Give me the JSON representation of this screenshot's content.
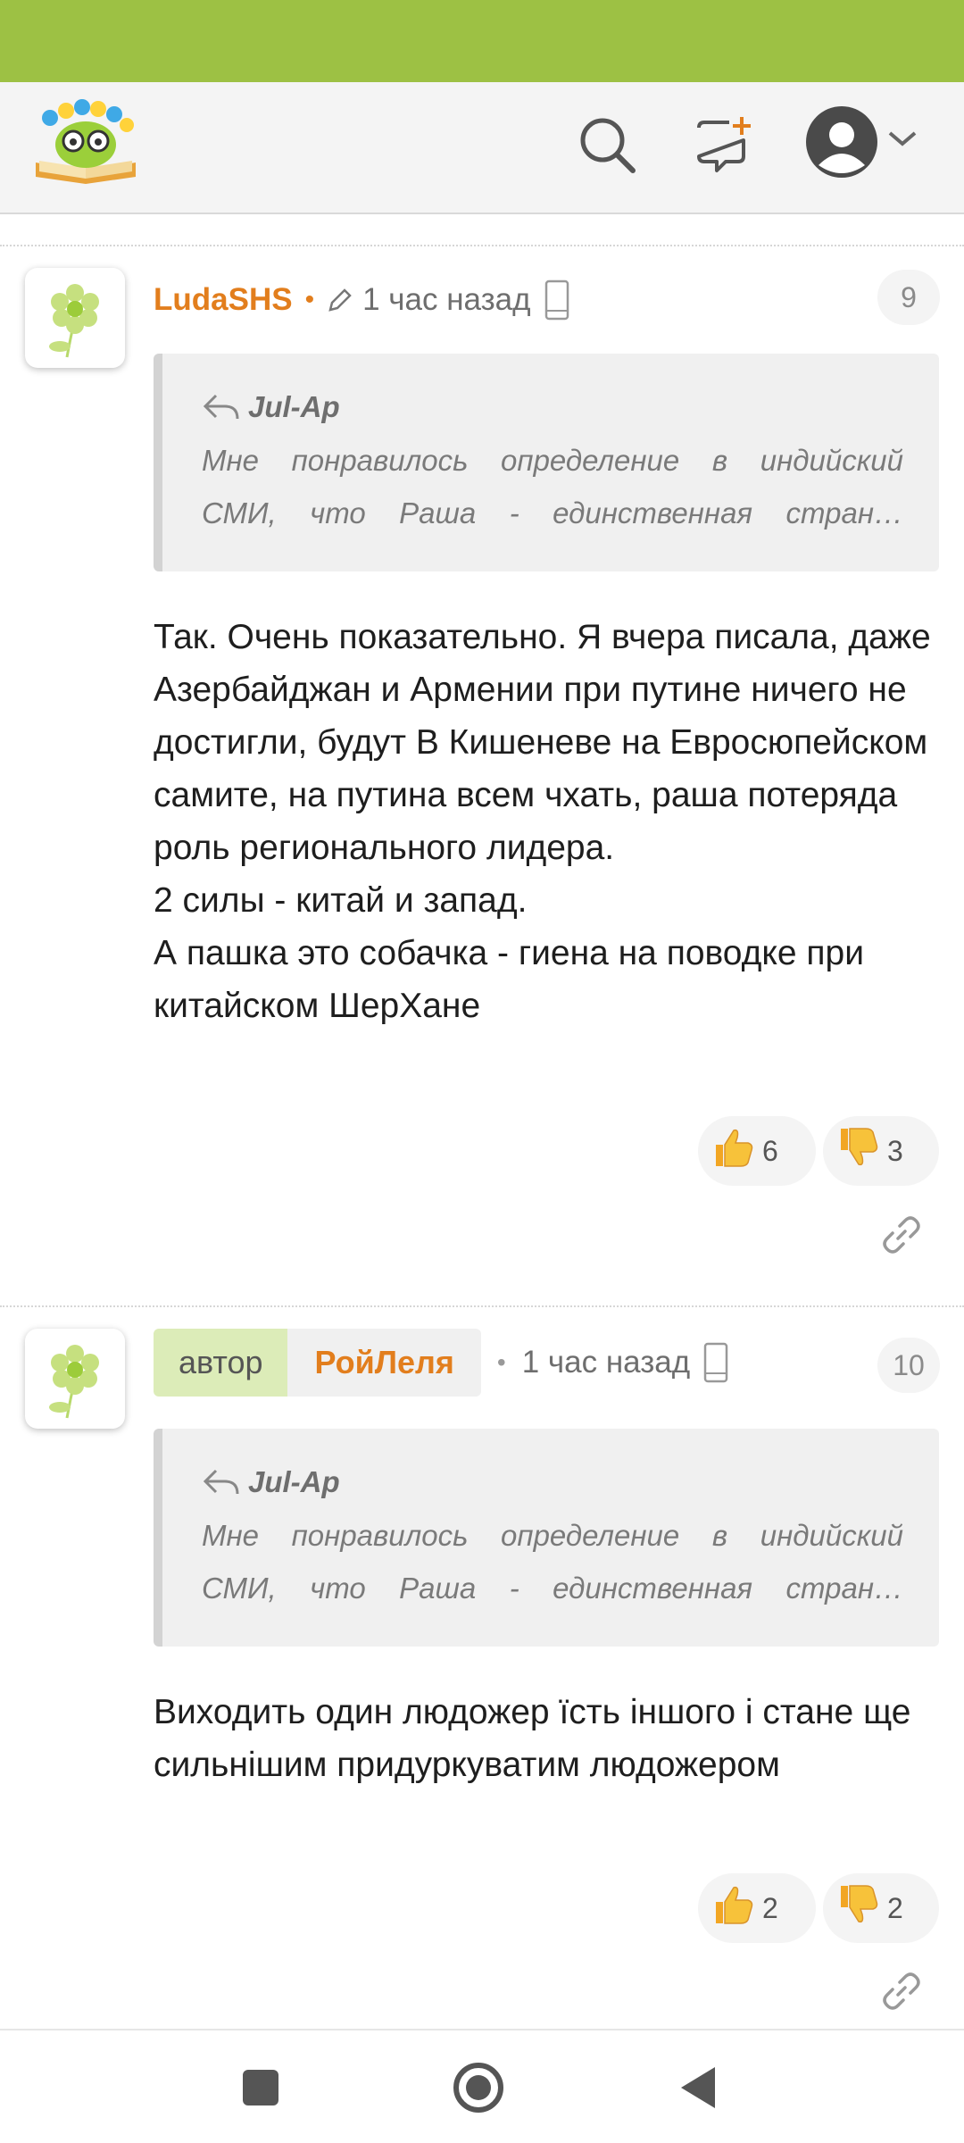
{
  "colors": {
    "status_bar": "#9dc144",
    "accent": "#e27e1d",
    "author_tag": "#dcecb8"
  },
  "header": {
    "logo_icon": "book-flower-logo",
    "search_icon": "search-icon",
    "new_post_icon": "new-message-icon",
    "avatar_icon": "user-avatar-icon"
  },
  "comments": [
    {
      "username": "LudaSHS",
      "time": "1 час назад",
      "number": "9",
      "quote_author": "Jul-Ap",
      "quote_line1": "Мне понравилось определение в индийский",
      "quote_line2": "СМИ, что Раша - единственная стран…",
      "body": "Так. Очень показательно. Я вчера писала, даже Азербайджан и Армении при путине ничего не достигли, будут В Кишеневе на Евросюпейском самите, на путина всем чхать, раша потеряда роль регионального лидера.\n2 силы - китай и запад.\nА пашка это собачка - гиена на поводке при китайском ШерХане",
      "likes": "6",
      "dislikes": "3"
    },
    {
      "author_label": "автор",
      "username": "РойЛеля",
      "time": "1 час назад",
      "number": "10",
      "quote_author": "Jul-Ap",
      "quote_line1": "Мне понравилось определение в индийский",
      "quote_line2": "СМИ, что Раша - единственная стран…",
      "body": "Виходить один людожер їсть іншого і стане ще сильнішим придуркуватим людожером",
      "likes": "2",
      "dislikes": "2"
    }
  ]
}
